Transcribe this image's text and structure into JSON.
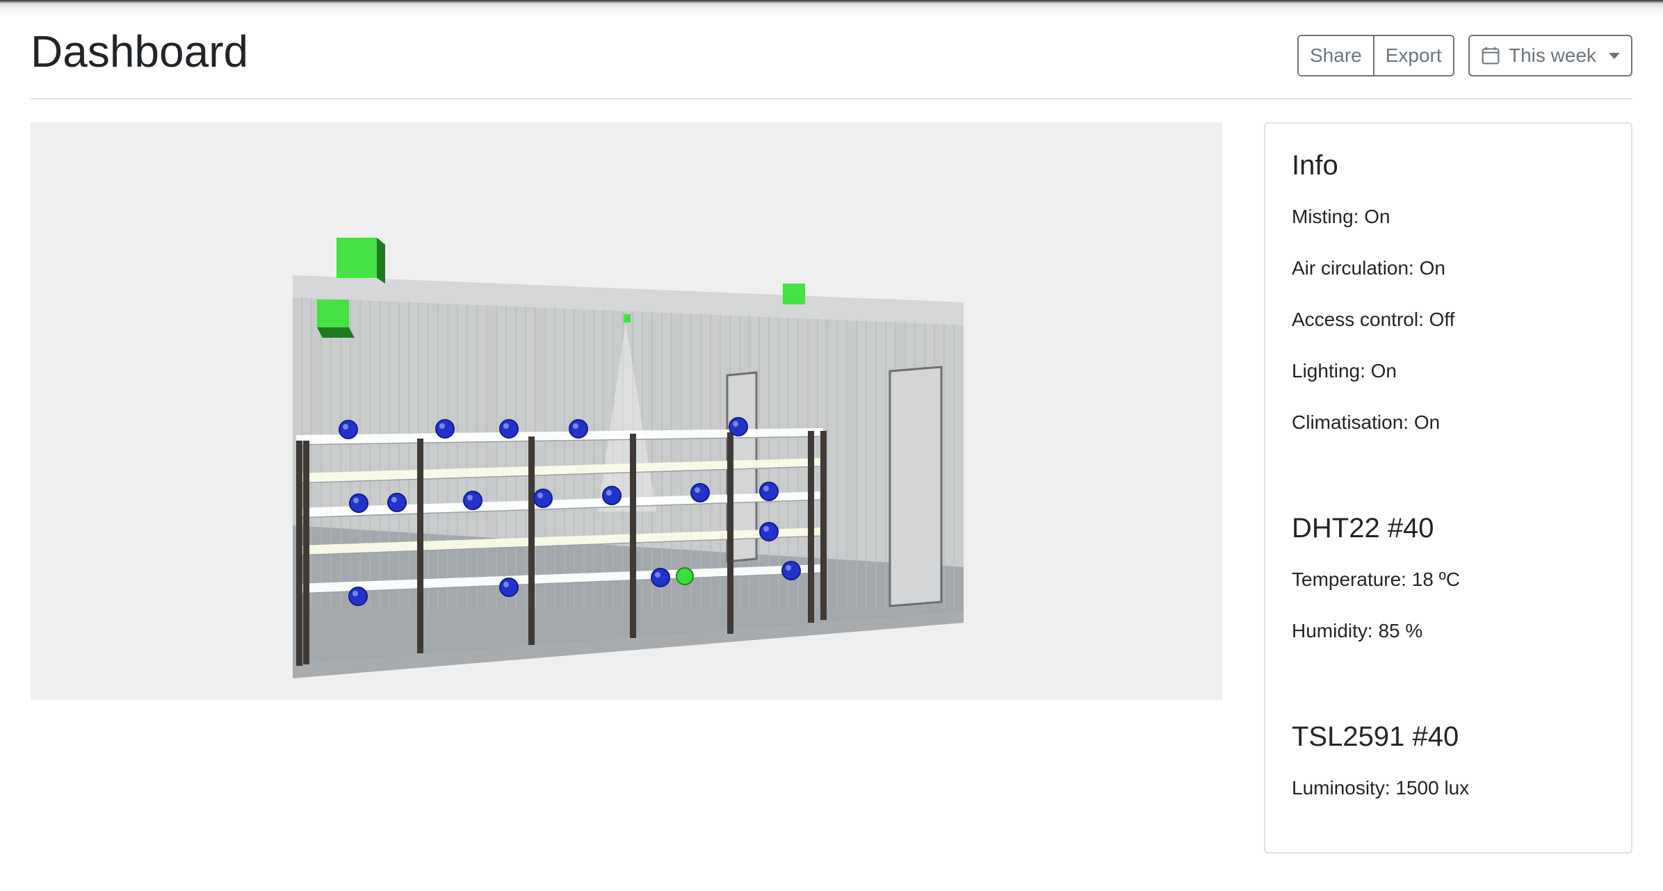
{
  "header": {
    "title": "Dashboard",
    "share_label": "Share",
    "export_label": "Export",
    "range_label": "This week"
  },
  "info": {
    "title": "Info",
    "lines": [
      "Misting: On",
      "Air circulation: On",
      "Access control: Off",
      "Lighting: On",
      "Climatisation: On"
    ]
  },
  "sensors": [
    {
      "title": "DHT22 #40",
      "lines": [
        "Temperature: 18 ºC",
        "Humidity: 85 %"
      ]
    },
    {
      "title": "TSL2591 #40",
      "lines": [
        "Luminosity: 1500 lux"
      ]
    }
  ],
  "colors": {
    "sensor_active": "#3ddc3d",
    "sensor_node": "#2233cc",
    "outline_button": "#6c757d"
  },
  "icons": {
    "range_button": "calendar-icon",
    "range_dropdown": "caret-down-icon"
  }
}
